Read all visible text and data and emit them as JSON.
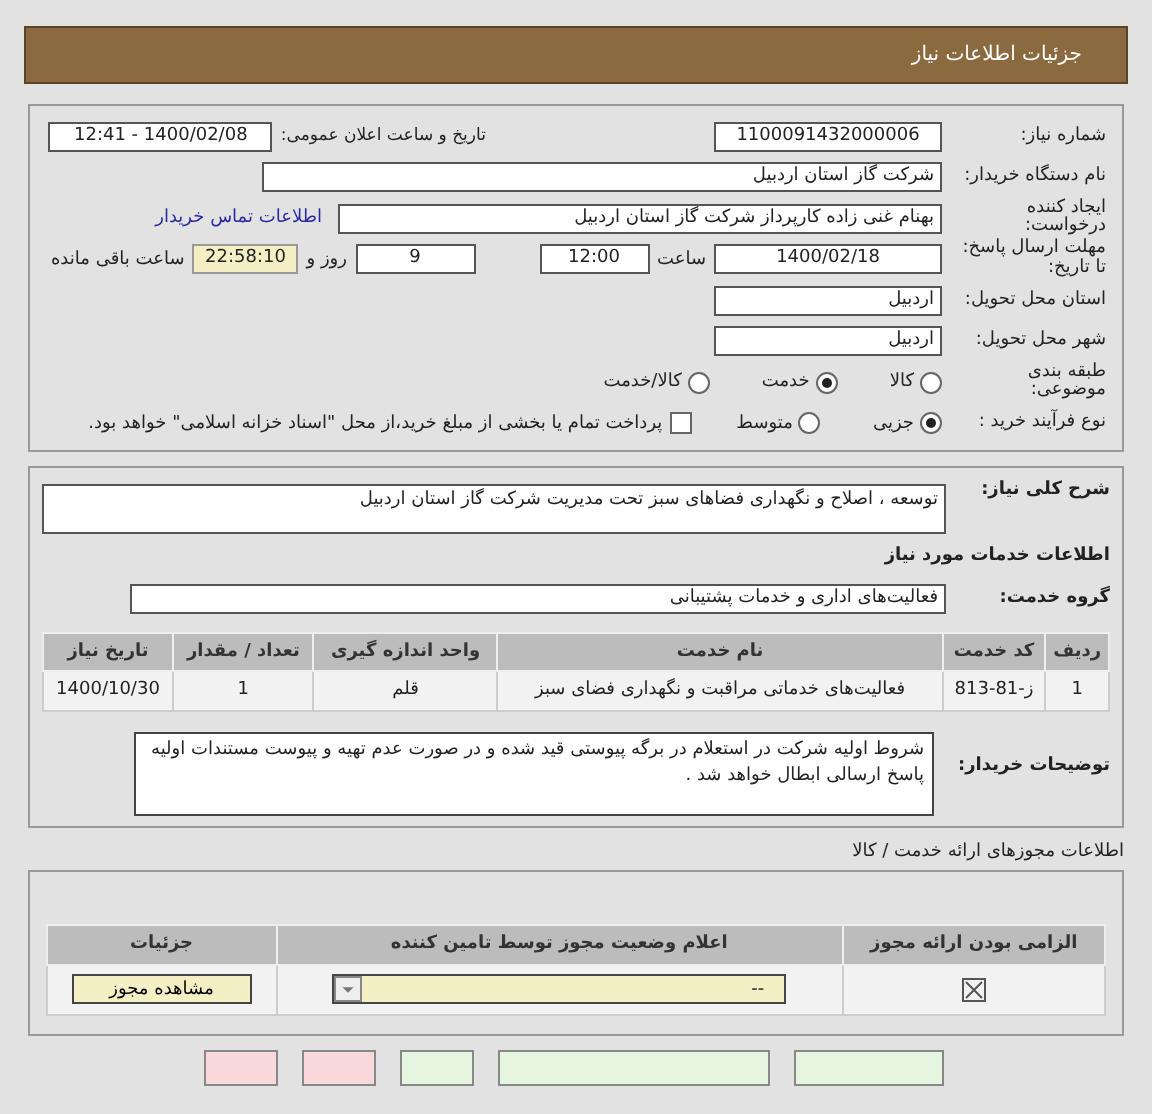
{
  "header": {
    "title": "جزئیات اطلاعات نیاز"
  },
  "need_number": {
    "label": "شماره نیاز:",
    "value": "1100091432000006"
  },
  "announce": {
    "label": "تاریخ و ساعت اعلان عمومی:",
    "value": "1400/02/08 - 12:41"
  },
  "buyer": {
    "label": "نام دستگاه خریدار:",
    "value": "شرکت گاز استان اردبیل"
  },
  "creator": {
    "label": "ایجاد کننده درخواست:",
    "value": "بهنام  غنی زاده  کارپرداز  شرکت گاز استان اردبیل",
    "link": "اطلاعات تماس خریدار"
  },
  "deadline": {
    "label": "مهلت ارسال پاسخ: تا تاریخ:",
    "date": "1400/02/18",
    "time_label": "ساعت",
    "time": "12:00",
    "days": "9",
    "days_label": "روز و",
    "remaining": "22:58:10",
    "remaining_label": "ساعت باقی مانده"
  },
  "province": {
    "label": "استان محل تحویل:",
    "value": "اردبیل"
  },
  "city": {
    "label": "شهر محل تحویل:",
    "value": "اردبیل"
  },
  "category": {
    "label": "طبقه بندی موضوعی:",
    "options": [
      {
        "label": "کالا",
        "selected": false
      },
      {
        "label": "خدمت",
        "selected": true
      },
      {
        "label": "کالا/خدمت",
        "selected": false
      }
    ]
  },
  "purchase_type": {
    "label": "نوع فرآیند خرید :",
    "options": [
      {
        "label": "جزیی",
        "selected": true
      },
      {
        "label": "متوسط",
        "selected": false
      }
    ],
    "payment": {
      "label": "پرداخت تمام یا بخشی از مبلغ خرید،از محل \"اسناد خزانه اسلامی\" خواهد بود.",
      "checked": false
    }
  },
  "description": {
    "label": "شرح کلی نیاز:",
    "value": "توسعه ، اصلاح و نگهداری فضاهای سبز تحت مدیریت شرکت گاز استان اردبیل"
  },
  "services_title": "اطلاعات خدمات مورد نیاز",
  "service_group": {
    "label": "گروه خدمت:",
    "value": "فعالیت‌های اداری و خدمات پشتیبانی"
  },
  "table": {
    "columns": [
      "ردیف",
      "کد خدمت",
      "نام خدمت",
      "واحد اندازه گیری",
      "تعداد / مقدار",
      "تاریخ نیاز"
    ],
    "rows": [
      [
        "1",
        "ز-81-813",
        "فعالیت‌های خدماتی مراقبت و نگهداری فضای سبز",
        "قلم",
        "1",
        "1400/10/30"
      ]
    ]
  },
  "buyer_notes": {
    "label": "توضیحات خریدار:",
    "value": "شروط اولیه شرکت در استعلام در برگه پیوستی قید شده و در صورت عدم تهیه و پیوست مستندات اولیه پاسخ ارسالی ابطال خواهد شد ."
  },
  "permits_title": "اطلاعات مجوزهای ارائه خدمت / کالا",
  "permits": {
    "columns": [
      "الزامی بودن ارائه مجوز",
      "اعلام وضعیت مجوز توسط تامین کننده",
      "جزئیات"
    ],
    "rows": [
      {
        "required": true,
        "status": "--",
        "button": "مشاهده مجوز"
      }
    ]
  },
  "buttons": [
    {
      "color": "#e6f5e0"
    },
    {
      "color": "#e6f5e0"
    },
    {
      "color": "#e6f5e0"
    },
    {
      "color": "#f8d8d8"
    },
    {
      "color": "#f8d8d8"
    }
  ]
}
